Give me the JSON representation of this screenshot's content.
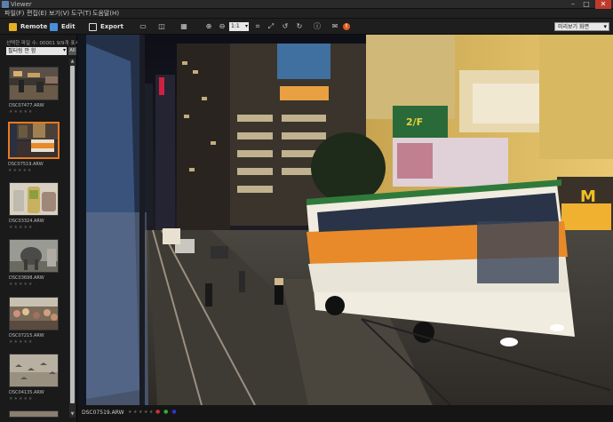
{
  "window": {
    "title": "Viewer"
  },
  "menu": [
    "파일(F)",
    "편집(E)",
    "보기(V)",
    "도구(T)",
    "도움말(H)"
  ],
  "toolbar": {
    "remote_label": "Remote",
    "edit_label": "Edit",
    "export_label": "Export",
    "zoom_value": "1:1",
    "notification_count": "!",
    "view_mode": "미리보기 화면"
  },
  "sidebar": {
    "selection_info": "선택한 파일 수: 00001  9/9개 표시",
    "filter_value": "필터링 안 함",
    "all_button": "All",
    "thumbnails": [
      {
        "name": "DSC07477.ARW",
        "stars": "★★★★★ ·",
        "selected": false,
        "scene": "street"
      },
      {
        "name": "DSC07519.ARW",
        "stars": "★★★★★ ·",
        "selected": true,
        "scene": "tram"
      },
      {
        "name": "DSC03324.ARW",
        "stars": "★★★★★ ·",
        "selected": false,
        "scene": "drinks"
      },
      {
        "name": "DSC03698.ARW",
        "stars": "★★★★★ ·",
        "selected": false,
        "scene": "elephant"
      },
      {
        "name": "DSC07215.ARW",
        "stars": "★★★★★ ·",
        "selected": false,
        "scene": "crowd"
      },
      {
        "name": "DSC04135.ARW",
        "stars": "★★★★★ ·",
        "selected": false,
        "scene": "birds"
      }
    ]
  },
  "status": {
    "filename": "DSC07519.ARW",
    "stars": "★★★★★",
    "color_labels": [
      "#c33",
      "#3a3",
      "#33c",
      "#cc3",
      "#c3c"
    ]
  },
  "colors": {
    "accent": "#e87a20",
    "bus_orange": "#e88a2a",
    "bus_green": "#2f7a3a"
  },
  "photo": {
    "signs": {
      "shop": "2/F",
      "mcd": "M"
    }
  }
}
